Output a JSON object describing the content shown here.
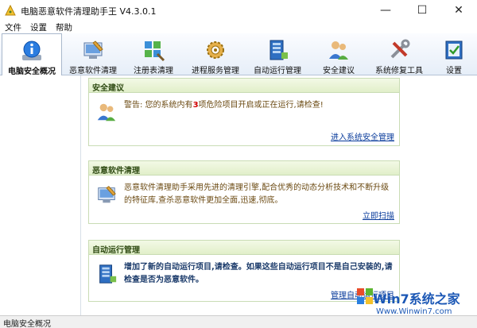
{
  "window": {
    "title": "电脑恶意软件清理助手王 V4.3.0.1",
    "minimize_glyph": "—",
    "maximize_glyph": "☐",
    "close_glyph": "✕"
  },
  "menu": [
    "文件",
    "设置",
    "帮助"
  ],
  "toolbar": {
    "items": [
      {
        "label": "电脑安全概况",
        "icon": "info-icon",
        "active": true
      },
      {
        "label": "恶意软件清理",
        "icon": "malware-clean-icon"
      },
      {
        "label": "注册表清理",
        "icon": "registry-icon"
      },
      {
        "label": "进程服务管理",
        "icon": "process-gear-icon"
      },
      {
        "label": "自动运行管理",
        "icon": "autorun-icon"
      },
      {
        "label": "安全建议",
        "icon": "users-advice-icon"
      },
      {
        "label": "系统修复工具",
        "icon": "repair-tools-icon"
      },
      {
        "label": "设置",
        "icon": "settings-icon"
      }
    ]
  },
  "cards": {
    "security": {
      "title": "安全建议",
      "text_before": "警告: 您的系统内有",
      "count": "3",
      "text_after": "项危险项目开启或正在运行,请检查!",
      "link": "进入系统安全管理"
    },
    "malware": {
      "title": "恶意软件清理",
      "text": "恶意软件清理助手采用先进的清理引擎,配合优秀的动态分析技术和不断升级的特征库,查杀恶意软件更加全面,迅速,彻底。",
      "link": "立即扫描"
    },
    "autorun": {
      "title": "自动运行管理",
      "text": "增加了新的自动运行项目,请检查。如果这些自动运行项目不是自己安装的,请检查是否为恶意软件。",
      "link": "管理自动运行项目"
    }
  },
  "status": {
    "text": "电脑安全概况"
  },
  "watermark": {
    "title": "Win7系统之家",
    "url": "Www.Winwin7.com"
  },
  "colors": {
    "accent_green": "#c9dcb4",
    "link_blue": "#0b3d9c",
    "warning_red": "#d10000",
    "body_text": "#6b4a12"
  }
}
